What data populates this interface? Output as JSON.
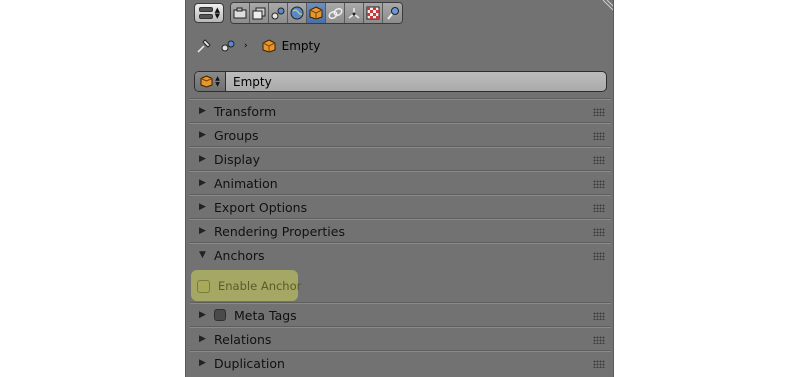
{
  "header": {
    "tabs": [
      {
        "icon": "render-icon",
        "active": false
      },
      {
        "icon": "render-layers-icon",
        "active": false
      },
      {
        "icon": "scene-icon",
        "active": false
      },
      {
        "icon": "world-icon",
        "active": false
      },
      {
        "icon": "object-icon",
        "active": true
      },
      {
        "icon": "constraints-icon",
        "active": false
      },
      {
        "icon": "modifiers-icon",
        "active": false
      },
      {
        "icon": "texture-icon",
        "active": false
      },
      {
        "icon": "physics-icon",
        "active": false
      }
    ]
  },
  "breadcrumb": {
    "object_name": "Empty"
  },
  "object_name_field": {
    "value": "Empty"
  },
  "panels": {
    "transform": "Transform",
    "groups": "Groups",
    "display": "Display",
    "animation": "Animation",
    "export_options": "Export Options",
    "rendering_properties": "Rendering Properties",
    "anchors": "Anchors",
    "meta_tags": "Meta Tags",
    "relations": "Relations",
    "duplication": "Duplication"
  },
  "anchors_panel": {
    "enable_anchor_label": "Enable Anchor",
    "enabled": false
  },
  "colors": {
    "panel_bg": "#727272",
    "highlight": "#cfd65a",
    "active_tab": "#4a6fa5",
    "object_orange": "#e8962e"
  }
}
